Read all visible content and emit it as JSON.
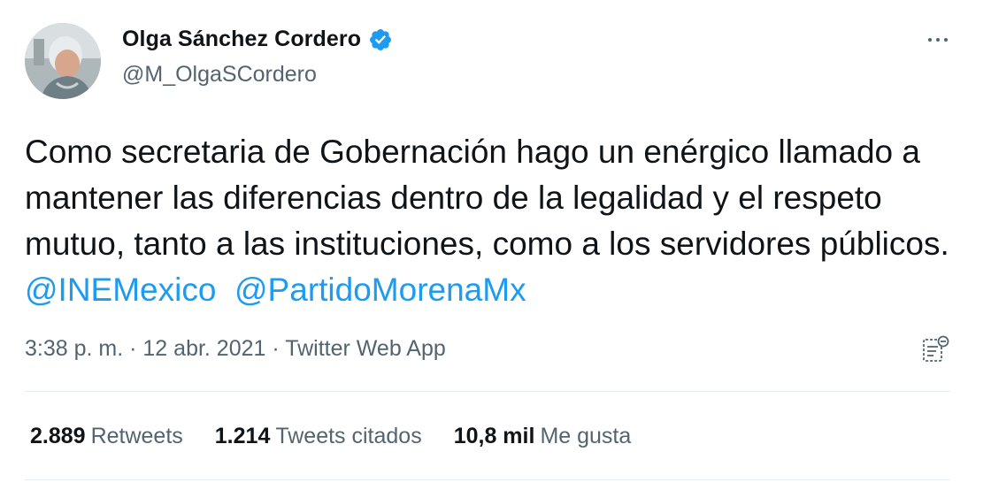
{
  "user": {
    "name": "Olga Sánchez Cordero",
    "handle": "@M_OlgaSCordero",
    "verified": true
  },
  "tweet": {
    "text_before": "Como secretaria de Gobernación hago un enérgico llamado a mantener las diferencias dentro de la legalidad y el respeto mutuo, tanto a las instituciones, como a los servidores públicos.",
    "mentions": [
      "@INEMexico",
      "@PartidoMorenaMx"
    ]
  },
  "meta": {
    "time": "3:38 p. m.",
    "separator": "·",
    "date": "12 abr. 2021",
    "source": "Twitter Web App"
  },
  "stats": {
    "retweets_count": "2.889",
    "retweets_label": "Retweets",
    "quotes_count": "1.214",
    "quotes_label": "Tweets citados",
    "likes_count": "10,8 mil",
    "likes_label": "Me gusta"
  },
  "colors": {
    "accent": "#1d9bf0",
    "text_primary": "#0f1419",
    "text_secondary": "#536471"
  },
  "icons": [
    "verified-badge-icon",
    "more-options-icon",
    "note-icon"
  ]
}
